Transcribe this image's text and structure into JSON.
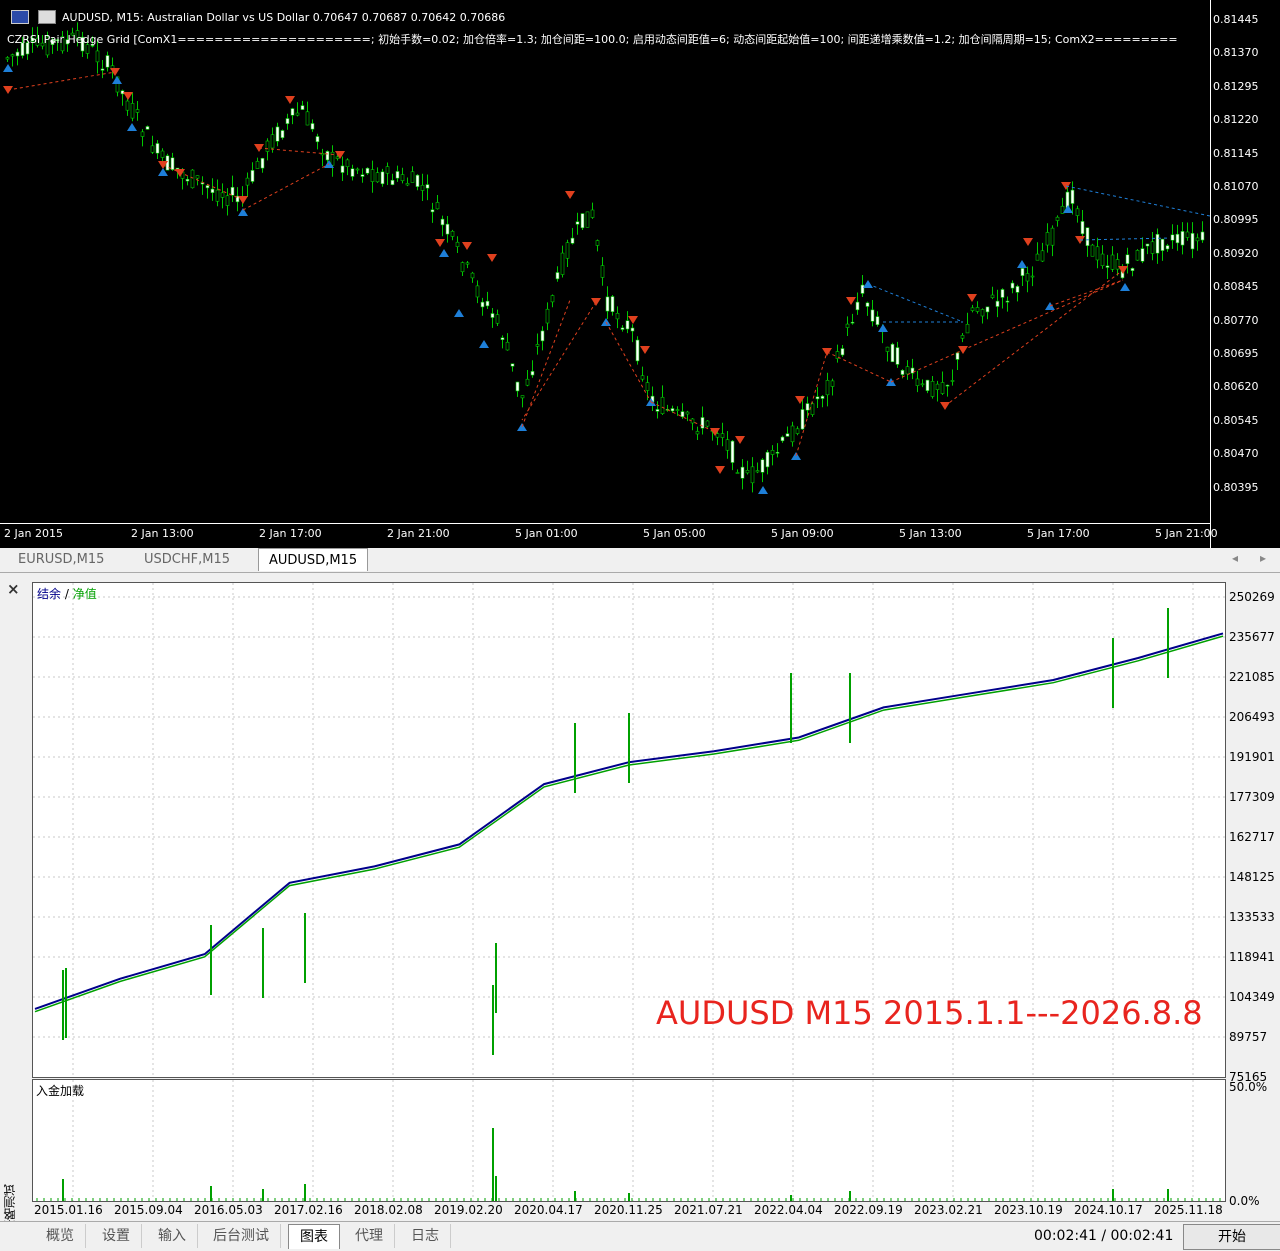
{
  "price_chart": {
    "title": "AUDUSD, M15:  Australian Dollar vs US Dollar  0.70647 0.70687 0.70642 0.70686",
    "indicator": "CZRSI Pair Hedge Grid [ComX1=====================; 初始手数=0.02; 加仓倍率=1.3; 加仓间距=100.0; 启用动态间距值=6; 动态间距起始值=100; 间距递增乘数值=1.2; 加仓间隔周期=15; ComX2=========",
    "y_labels": [
      "0.81445",
      "0.81370",
      "0.81295",
      "0.81220",
      "0.81145",
      "0.81070",
      "0.80995",
      "0.80920",
      "0.80845",
      "0.80770",
      "0.80695",
      "0.80620",
      "0.80545",
      "0.80470",
      "0.80395"
    ],
    "x_labels": [
      "2 Jan 2015",
      "2 Jan 13:00",
      "2 Jan 17:00",
      "2 Jan 21:00",
      "5 Jan 01:00",
      "5 Jan 05:00",
      "5 Jan 09:00",
      "5 Jan 13:00",
      "5 Jan 17:00",
      "5 Jan 21:00"
    ],
    "colors": {
      "bull": "#ffffff",
      "bear": "#000000",
      "wick": "#00c800",
      "buy_arrow": "#1e7fd8",
      "sell_arrow": "#e0401e"
    }
  },
  "symbol_tabs": [
    "EURUSD,M15",
    "USDCHF,M15",
    "AUDUSD,M15"
  ],
  "tester": {
    "close": "×",
    "side_label": "策略测试",
    "legend_balance": "结余",
    "legend_sep": " / ",
    "legend_equity": "净值",
    "deposit_label": "入金加载",
    "overlay_title": "AUDUSD M15 2015.1.1---2026.8.8",
    "load_max": "50.0%",
    "load_min": "0.0%",
    "y_labels": [
      "250269",
      "235677",
      "221085",
      "206493",
      "191901",
      "177309",
      "162717",
      "148125",
      "133533",
      "118941",
      "104349",
      "89757",
      "75165"
    ],
    "x_labels": [
      "2015.01.16",
      "2015.09.04",
      "2016.05.03",
      "2017.02.16",
      "2018.02.08",
      "2019.02.20",
      "2020.04.17",
      "2020.11.25",
      "2021.07.21",
      "2022.04.04",
      "2022.09.19",
      "2023.02.21",
      "2023.10.19",
      "2024.10.17",
      "2025.11.18"
    ],
    "colors": {
      "balance": "#00008b",
      "equity": "#00a000",
      "title": "#e8241e"
    }
  },
  "chart_data": {
    "type": "line",
    "title": "",
    "x": [
      "2015.01.16",
      "2015.09.04",
      "2016.05.03",
      "2017.02.16",
      "2018.02.08",
      "2019.02.20",
      "2020.04.17",
      "2020.11.25",
      "2021.07.21",
      "2022.04.04",
      "2022.09.19",
      "2023.02.21",
      "2023.10.19",
      "2024.10.17",
      "2025.11.18"
    ],
    "series": [
      {
        "name": "结余",
        "values": [
          100000,
          111000,
          120000,
          146000,
          152000,
          160000,
          182000,
          190000,
          194000,
          199000,
          210000,
          215000,
          220000,
          228000,
          237000
        ]
      },
      {
        "name": "净值",
        "values": [
          99000,
          110000,
          119000,
          145000,
          151000,
          159000,
          181000,
          189000,
          193000,
          198000,
          209000,
          214000,
          219000,
          227000,
          236000
        ]
      }
    ],
    "ylim": [
      75165,
      250269
    ]
  },
  "bottom_tabs": [
    "概览",
    "设置",
    "输入",
    "后台测试",
    "图表",
    "代理",
    "日志"
  ],
  "timer": "00:02:41 / 00:02:41",
  "start_button": "开始"
}
